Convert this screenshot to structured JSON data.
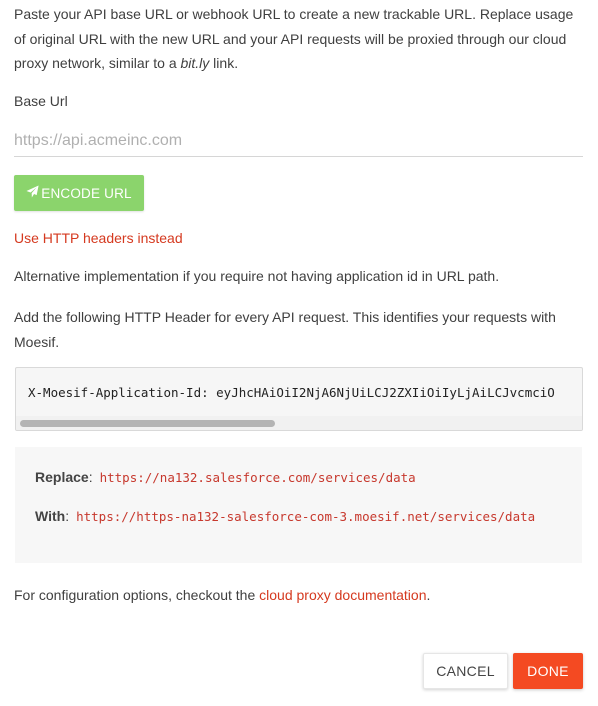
{
  "intro": {
    "text_before": "Paste your API base URL or webhook URL to create a new trackable URL. Replace usage of original URL with the new URL and your API requests will be proxied through our cloud proxy network, similar to a ",
    "emphasis": "bit.ly",
    "text_after": " link."
  },
  "base_url": {
    "label": "Base Url",
    "placeholder": "https://api.acmeinc.com",
    "value": ""
  },
  "encode_button": {
    "label": "ENCODE URL",
    "icon": "paper-plane-icon"
  },
  "http_headers_link": "Use HTTP headers instead",
  "alternative_text": "Alternative implementation if you require not having application id in URL path.",
  "add_header_text": "Add the following HTTP Header for every API request. This identifies your requests with Moesif.",
  "header_code": "X-Moesif-Application-Id: eyJhcHAiOiI2NjA6NjUiLCJ2ZXIiOiIyLjAiLCJvcmciO",
  "replace": {
    "replace_label": "Replace",
    "replace_value": "https://na132.salesforce.com/services/data",
    "with_label": "With",
    "with_value": "https://https-na132-salesforce-com-3.moesif.net/services/data"
  },
  "config": {
    "text": "For configuration options, checkout the ",
    "link": "cloud proxy documentation",
    "suffix": "."
  },
  "buttons": {
    "cancel": "CANCEL",
    "done": "DONE"
  },
  "colors": {
    "accent": "#f44a22",
    "link": "#d5391f",
    "encode_button": "#8bd46c",
    "code_text": "#c7382d"
  }
}
